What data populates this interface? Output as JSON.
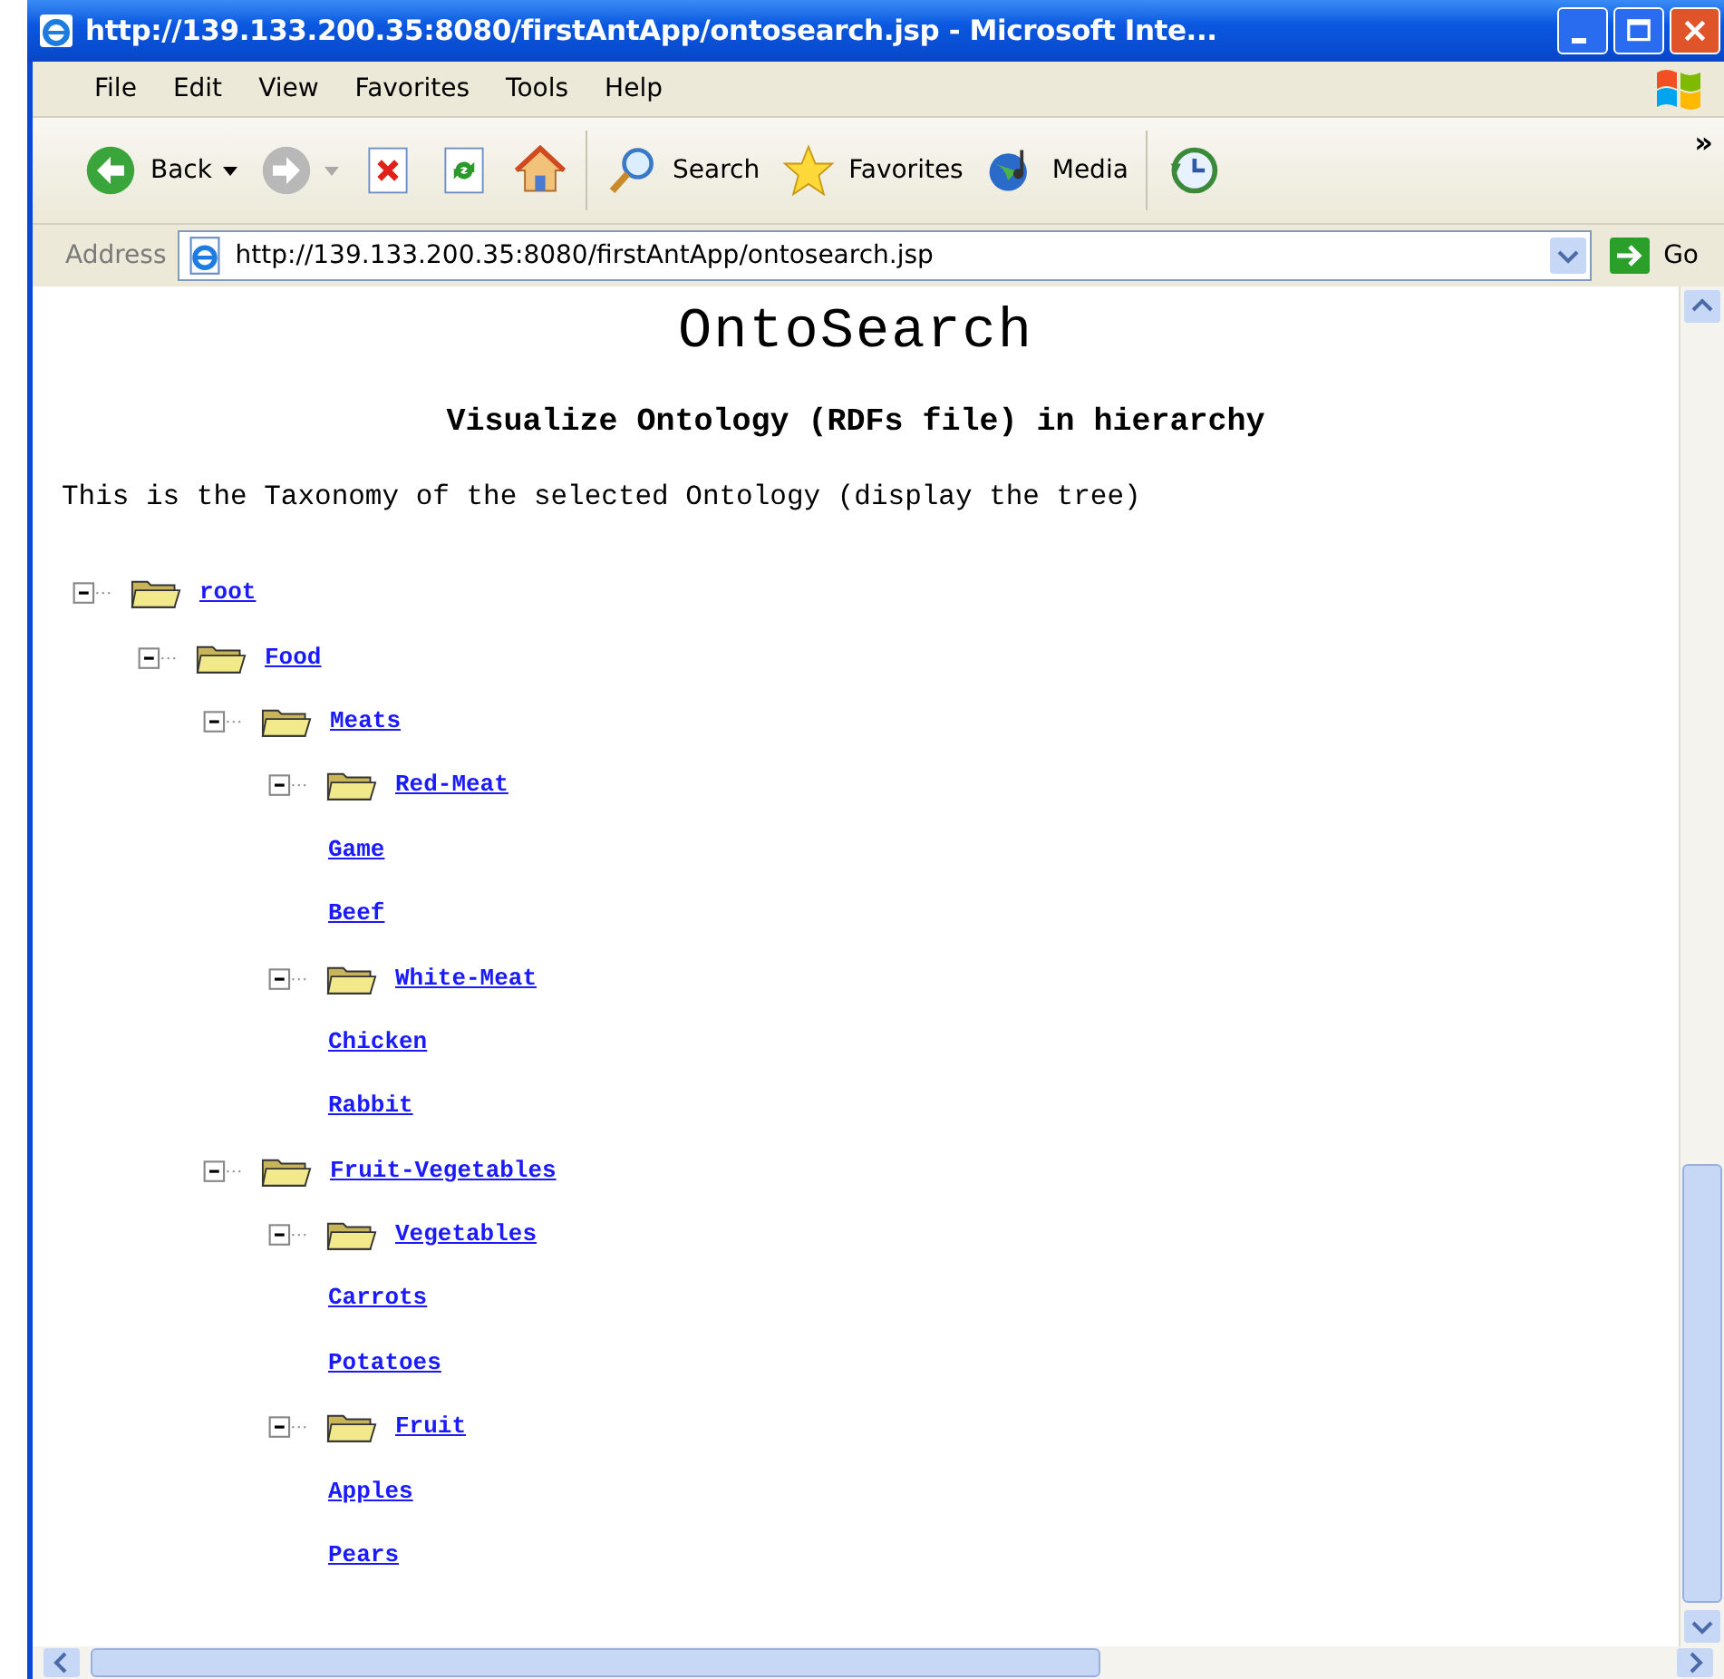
{
  "window": {
    "title": "http://139.133.200.35:8080/firstAntApp/ontosearch.jsp - Microsoft Inte..."
  },
  "menu": [
    "File",
    "Edit",
    "View",
    "Favorites",
    "Tools",
    "Help"
  ],
  "toolbar": {
    "buttons": [
      {
        "kind": "back",
        "label": "Back"
      },
      {
        "kind": "forward"
      },
      {
        "kind": "stop"
      },
      {
        "kind": "refresh"
      },
      {
        "kind": "home"
      },
      {
        "kind": "search",
        "label": "Search"
      },
      {
        "kind": "favorites",
        "label": "Favorites"
      },
      {
        "kind": "media",
        "label": "Media"
      },
      {
        "kind": "history"
      }
    ],
    "overflow": "»"
  },
  "address_bar": {
    "label": "Address",
    "value": "http://139.133.200.35:8080/firstAntApp/ontosearch.jsp",
    "go": "Go"
  },
  "page": {
    "title": "OntoSearch",
    "subtitle": "Visualize Ontology (RDFs file) in hierarchy",
    "intro": "This is the Taxonomy of the selected Ontology (display the tree)",
    "tree": [
      {
        "label": "root",
        "expanded": true,
        "children": [
          {
            "label": "Food",
            "expanded": true,
            "children": [
              {
                "label": "Meats",
                "expanded": true,
                "children": [
                  {
                    "label": "Red-Meat",
                    "expanded": true,
                    "children": [
                      {
                        "label": "Game"
                      },
                      {
                        "label": "Beef"
                      }
                    ]
                  },
                  {
                    "label": "White-Meat",
                    "expanded": true,
                    "children": [
                      {
                        "label": "Chicken"
                      },
                      {
                        "label": "Rabbit"
                      }
                    ]
                  }
                ]
              },
              {
                "label": "Fruit-Vegetables",
                "expanded": true,
                "children": [
                  {
                    "label": "Vegetables",
                    "expanded": true,
                    "children": [
                      {
                        "label": "Carrots"
                      },
                      {
                        "label": "Potatoes"
                      }
                    ]
                  },
                  {
                    "label": "Fruit",
                    "expanded": true,
                    "children": [
                      {
                        "label": "Apples"
                      },
                      {
                        "label": "Pears"
                      }
                    ]
                  }
                ]
              }
            ]
          }
        ]
      }
    ]
  }
}
